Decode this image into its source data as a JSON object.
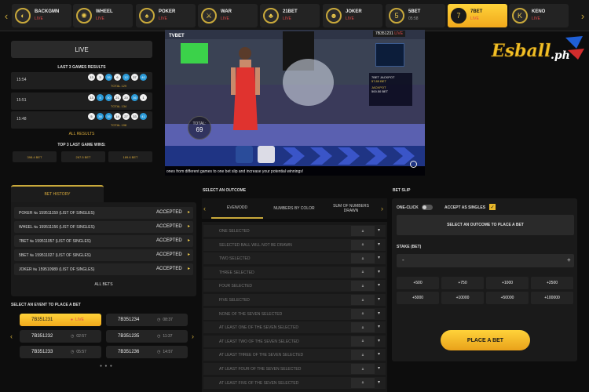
{
  "nav": {
    "tabs": [
      {
        "name": "BACKGMN",
        "status": "LIVE",
        "live": true,
        "icon": "backgammon-icon",
        "glyph": "◐"
      },
      {
        "name": "WHEEL",
        "status": "LIVE",
        "live": true,
        "icon": "wheel-icon",
        "glyph": "✺"
      },
      {
        "name": "POKER",
        "status": "LIVE",
        "live": true,
        "icon": "poker-icon",
        "glyph": "♠"
      },
      {
        "name": "WAR",
        "status": "LIVE",
        "live": true,
        "icon": "war-icon",
        "glyph": "⚔"
      },
      {
        "name": "21BET",
        "status": "LIVE",
        "live": true,
        "icon": "cards-icon",
        "glyph": "♣"
      },
      {
        "name": "JOKER",
        "status": "LIVE",
        "live": true,
        "icon": "joker-icon",
        "glyph": "☻"
      },
      {
        "name": "5BET",
        "status": "05:58",
        "live": false,
        "icon": "5bet-icon",
        "glyph": "5"
      },
      {
        "name": "7BET",
        "status": "LIVE",
        "live": true,
        "icon": "7bet-icon",
        "glyph": "7"
      },
      {
        "name": "KENO",
        "status": "LIVE",
        "live": true,
        "icon": "keno-icon",
        "glyph": "K"
      }
    ],
    "active_index": 7
  },
  "results": {
    "live_label": "LIVE",
    "title": "LAST 3 GAMES RESULTS",
    "rows": [
      {
        "time": "15:54",
        "balls": [
          "13",
          "3",
          "35",
          "6",
          "12",
          "37",
          "40"
        ],
        "blue": [
          2,
          4,
          6
        ],
        "total": "TOTAL 129"
      },
      {
        "time": "15:51",
        "balls": [
          "13",
          "4",
          "30",
          "21",
          "20",
          "36",
          "1"
        ],
        "blue": [
          1,
          2,
          5
        ],
        "total": "TOTAL 134"
      },
      {
        "time": "15:48",
        "balls": [
          "5",
          "38",
          "35",
          "14",
          "27",
          "33",
          "41"
        ],
        "blue": [
          1,
          2,
          6
        ],
        "total": "TOTAL 198"
      }
    ],
    "all_results": "ALL RESULTS",
    "wins_title": "TOP 3 LAST GAME WINS:",
    "wins": [
      "398.4 BET",
      "267.5 BET",
      "189.6 BET"
    ]
  },
  "video": {
    "brand": "TVBET",
    "game_id": "7B351231",
    "game_status": "LIVE",
    "total_label": "TOTAL:",
    "total_value": "69",
    "jackpot_label": "7BET JACKPOT",
    "jackpot_value": "57.89 BET",
    "jackpot2_label": "JACKPOT",
    "jackpot2_value": "500.50 BET",
    "ticker": "ones from different games to one bet slip and increase your potential winnings!"
  },
  "logo": {
    "main": "Esball",
    "suffix": ".ph"
  },
  "bet_history": {
    "tab": "BET HISTORY",
    "rows": [
      {
        "name": "POKER № 159511159 (LIST OF SINGLES)",
        "status": "ACCEPTED"
      },
      {
        "name": "WHEEL № 159511156 (LIST OF SINGLES)",
        "status": "ACCEPTED"
      },
      {
        "name": "7BET № 159511057 (LIST OF SINGLES)",
        "status": "ACCEPTED"
      },
      {
        "name": "5BET № 159511027 (LIST OF SINGLES)",
        "status": "ACCEPTED"
      },
      {
        "name": "JOKER № 159510989 (LIST OF SINGLES)",
        "status": "ACCEPTED"
      }
    ],
    "all_bets": "ALL BETS"
  },
  "events": {
    "title": "SELECT AN EVENT TO PLACE A BET",
    "items": [
      {
        "id": "7B351231",
        "status": "LIVE"
      },
      {
        "id": "7B351234",
        "status": "08:37"
      },
      {
        "id": "7B351232",
        "status": "02:57"
      },
      {
        "id": "7B351235",
        "status": "11:37"
      },
      {
        "id": "7B351233",
        "status": "05:57"
      },
      {
        "id": "7B351236",
        "status": "14:57"
      }
    ],
    "pager": "● ● ●"
  },
  "outcome": {
    "title": "SELECT AN OUTCOME",
    "tabs": [
      "EVEN/ODD",
      "NUMBERS BY COLOR",
      "SUM OF NUMBERS DRAWN"
    ],
    "rows": [
      "ONE SELECTED",
      "SELECTED BALL WILL NOT BE DRAWN",
      "TWO SELECTED",
      "THREE SELECTED",
      "FOUR SELECTED",
      "FIVE SELECTED",
      "NONE OF THE SEVEN SELECTED",
      "AT LEAST ONE OF THE SEVEN SELECTED",
      "AT LEAST TWO OF THE SEVEN SELECTED",
      "AT LEAST THREE OF THE SEVEN SELECTED",
      "AT LEAST FOUR OF THE SEVEN SELECTED",
      "AT LEAST FIVE OF THE SEVEN SELECTED"
    ]
  },
  "slip": {
    "title": "BET SLIP",
    "one_click": "ONE-CLICK",
    "accept_singles": "ACCEPT AS SINGLES",
    "select_prompt": "SELECT AN OUTCOME TO PLACE A BET",
    "stake_label": "STAKE (BET)",
    "minus": "-",
    "plus": "+",
    "chips": [
      "+500",
      "+750",
      "+1000",
      "+2500",
      "+5000",
      "+10000",
      "+50000",
      "+100000"
    ],
    "place_label": "PLACE A BET"
  },
  "colors": {
    "accent": "#f0b428",
    "live": "#e34b4b",
    "ball_blue": "#2b9bd9"
  }
}
